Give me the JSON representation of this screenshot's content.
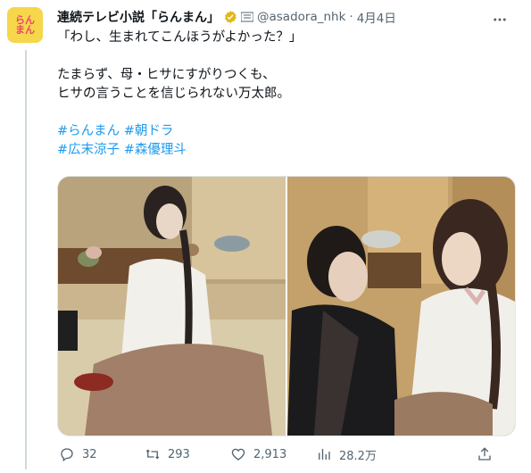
{
  "tweet": {
    "avatar_text": "らん\nまん",
    "display_name": "連続テレビ小説「らんまん」",
    "handle": "@asadora_nhk",
    "separator": "·",
    "date": "4月4日",
    "lines": [
      "「わし、生まれてこんほうがよかった？」",
      "",
      "たまらず、母・ヒサにすがりつくも、",
      "ヒサの言うことを信じられない万太郎。",
      ""
    ],
    "hashtags_line1": [
      "#らんまん",
      "#朝ドラ"
    ],
    "hashtags_line2": [
      "#広末涼子",
      "#森優理斗"
    ]
  },
  "media": {
    "photos": [
      {
        "icon": "photo-woman-sitting"
      },
      {
        "icon": "photo-mother-and-child"
      }
    ]
  },
  "actions": {
    "reply_count": "32",
    "retweet_count": "293",
    "like_count": "2,913",
    "view_count": "28.2万"
  },
  "colors": {
    "accent": "#1d9bf0",
    "text": "#0f1419",
    "secondary": "#536471",
    "verified_gold": "#e2b719",
    "avatar_bg": "#f6d64a"
  }
}
